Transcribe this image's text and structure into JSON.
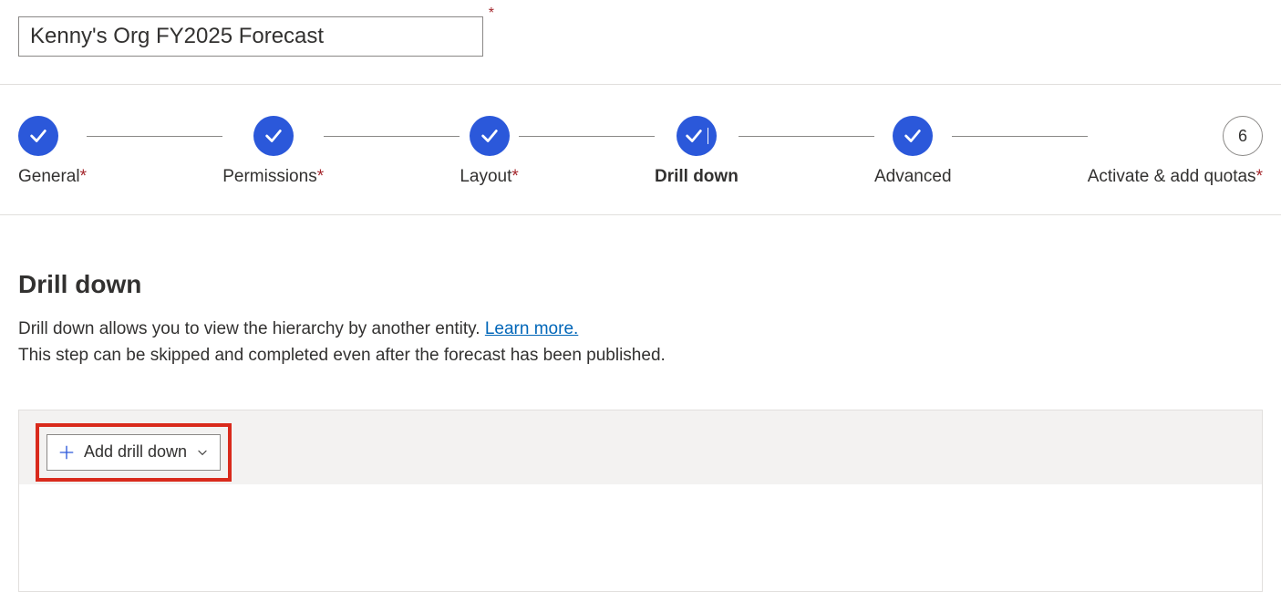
{
  "header": {
    "forecast_name": "Kenny's Org FY2025 Forecast"
  },
  "stepper": {
    "steps": [
      {
        "label": "General",
        "required": true,
        "state": "done",
        "value": ""
      },
      {
        "label": "Permissions",
        "required": true,
        "state": "done",
        "value": ""
      },
      {
        "label": "Layout",
        "required": true,
        "state": "done",
        "value": ""
      },
      {
        "label": "Drill down",
        "required": false,
        "state": "current",
        "value": ""
      },
      {
        "label": "Advanced",
        "required": false,
        "state": "done",
        "value": ""
      },
      {
        "label": "Activate & add quotas",
        "required": true,
        "state": "pending",
        "value": "6"
      }
    ]
  },
  "drilldown": {
    "title": "Drill down",
    "desc_line1_a": "Drill down allows you to view the hierarchy by another entity. ",
    "learn_more": "Learn more.",
    "desc_line2": "This step can be skipped and completed even after the forecast has been published.",
    "add_button_label": "Add drill down"
  },
  "annotation": {
    "highlight_target": "add-drill-down-button"
  }
}
